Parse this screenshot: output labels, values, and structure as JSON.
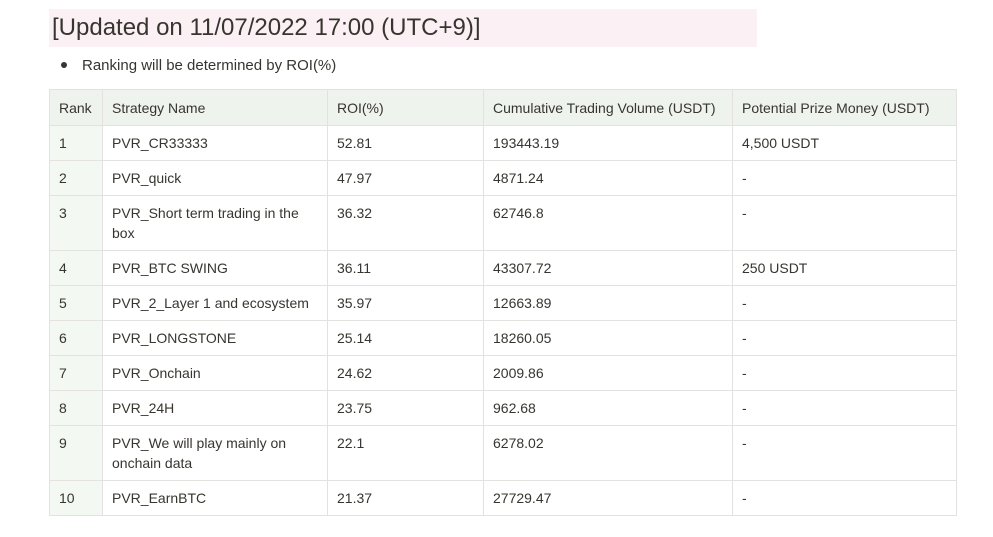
{
  "heading": "[Updated on 11/07/2022 17:00 (UTC+9)]",
  "bullet": "Ranking will be determined by ROI(%)",
  "colors": {
    "heading_bg": "#fbf1f4",
    "header_bg": "#eef3ed",
    "rank_col_bg": "#f4f8f3",
    "border": "#e3e2e0",
    "text": "#37352f"
  },
  "table": {
    "headers": [
      "Rank",
      "Strategy Name",
      "ROI(%)",
      "Cumulative Trading Volume (USDT)",
      "Potential Prize Money (USDT)"
    ],
    "rows": [
      {
        "rank": "1",
        "name": "PVR_CR33333",
        "roi": "52.81",
        "volume": "193443.19",
        "prize": "4,500 USDT"
      },
      {
        "rank": "2",
        "name": "PVR_quick",
        "roi": "47.97",
        "volume": "4871.24",
        "prize": "-"
      },
      {
        "rank": "3",
        "name": "PVR_Short term trading in the box",
        "roi": "36.32",
        "volume": "62746.8",
        "prize": "-"
      },
      {
        "rank": "4",
        "name": "PVR_BTC SWING",
        "roi": "36.11",
        "volume": "43307.72",
        "prize": "250 USDT"
      },
      {
        "rank": "5",
        "name": "PVR_2_Layer 1 and ecosystem",
        "roi": "35.97",
        "volume": "12663.89",
        "prize": "-"
      },
      {
        "rank": "6",
        "name": "PVR_LONGSTONE",
        "roi": "25.14",
        "volume": "18260.05",
        "prize": "-"
      },
      {
        "rank": "7",
        "name": "PVR_Onchain",
        "roi": "24.62",
        "volume": "2009.86",
        "prize": "-"
      },
      {
        "rank": "8",
        "name": "PVR_24H",
        "roi": "23.75",
        "volume": "962.68",
        "prize": "-"
      },
      {
        "rank": "9",
        "name": "PVR_We will play mainly on onchain data",
        "roi": "22.1",
        "volume": "6278.02",
        "prize": "-"
      },
      {
        "rank": "10",
        "name": "PVR_EarnBTC",
        "roi": "21.37",
        "volume": "27729.47",
        "prize": "-"
      }
    ]
  }
}
